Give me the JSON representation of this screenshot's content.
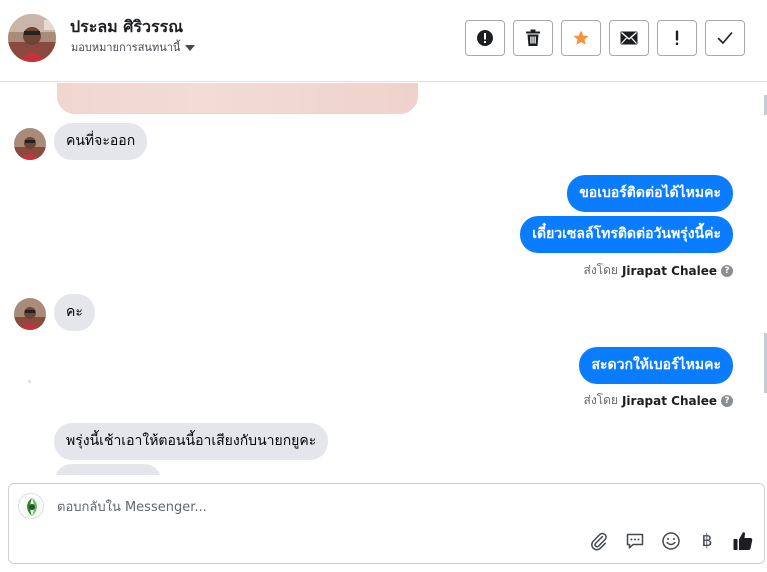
{
  "header": {
    "contact_name": "ประลม ศิริวรรณ",
    "assign_label": "มอบหมายการสนทนานี้",
    "actions": [
      {
        "name": "spam-button",
        "icon": "alert-circle-icon"
      },
      {
        "name": "delete-button",
        "icon": "trash-icon"
      },
      {
        "name": "star-button",
        "icon": "star-icon",
        "accent": "#f7923b"
      },
      {
        "name": "mark-unread-button",
        "icon": "envelope-icon"
      },
      {
        "name": "follow-up-button",
        "icon": "exclamation-icon"
      },
      {
        "name": "mark-done-button",
        "icon": "check-icon"
      }
    ]
  },
  "messages": [
    {
      "direction": "in",
      "text": "คนที่จะออก"
    },
    {
      "direction": "out",
      "text": "ขอเบอร์ติดต่อได้ไหมคะ"
    },
    {
      "direction": "out",
      "text": "เดี๋ยวเซลล์โทรติดต่อวันพรุ่งนี้ค่ะ"
    },
    {
      "direction": "in",
      "text": "คะ"
    },
    {
      "direction": "out",
      "text": "สะดวกให้เบอร์ไหมคะ"
    },
    {
      "direction": "in",
      "text": "พรุ่งนี้เช้าเอาให้ตอนนี้อาเสียงกับนายกยูคะ"
    }
  ],
  "sent_by": {
    "prefix": "ส่งโดย",
    "name": "Jirapat Chalee"
  },
  "reply": {
    "placeholder": "ตอบกลับใน Messenger..."
  },
  "tools": [
    "paperclip-icon",
    "saved-reply-icon",
    "emoji-icon",
    "baht-icon",
    "thumbs-up-icon"
  ],
  "colors": {
    "outgoing_bubble": "#0a7cff",
    "incoming_bubble": "#e4e6eb",
    "star": "#f7923b"
  },
  "baht_symbol": "฿"
}
